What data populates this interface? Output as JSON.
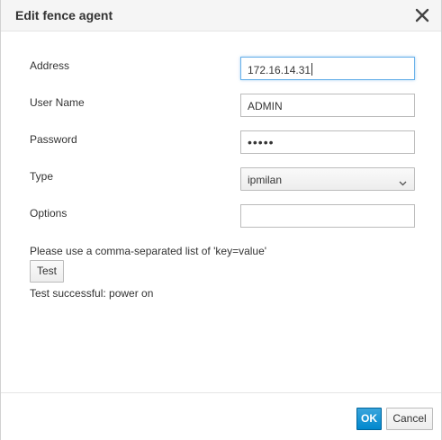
{
  "dialog": {
    "title": "Edit fence agent",
    "close_icon": "close-icon"
  },
  "form": {
    "address": {
      "label": "Address",
      "value": "172.16.14.31"
    },
    "username": {
      "label": "User Name",
      "value": "ADMIN"
    },
    "password": {
      "label": "Password",
      "masked": "•••••"
    },
    "type": {
      "label": "Type",
      "value": "ipmilan",
      "icon": "chevron-down-icon"
    },
    "options": {
      "label": "Options",
      "value": ""
    }
  },
  "hint": "Please use a comma-separated list of 'key=value'",
  "test_button": "Test",
  "status": "Test successful: power on",
  "footer": {
    "ok_label": "OK",
    "cancel_label": "Cancel"
  },
  "colors": {
    "primary": "#0088ce",
    "focus": "#66afe9",
    "header_bg": "#f5f5f5"
  }
}
